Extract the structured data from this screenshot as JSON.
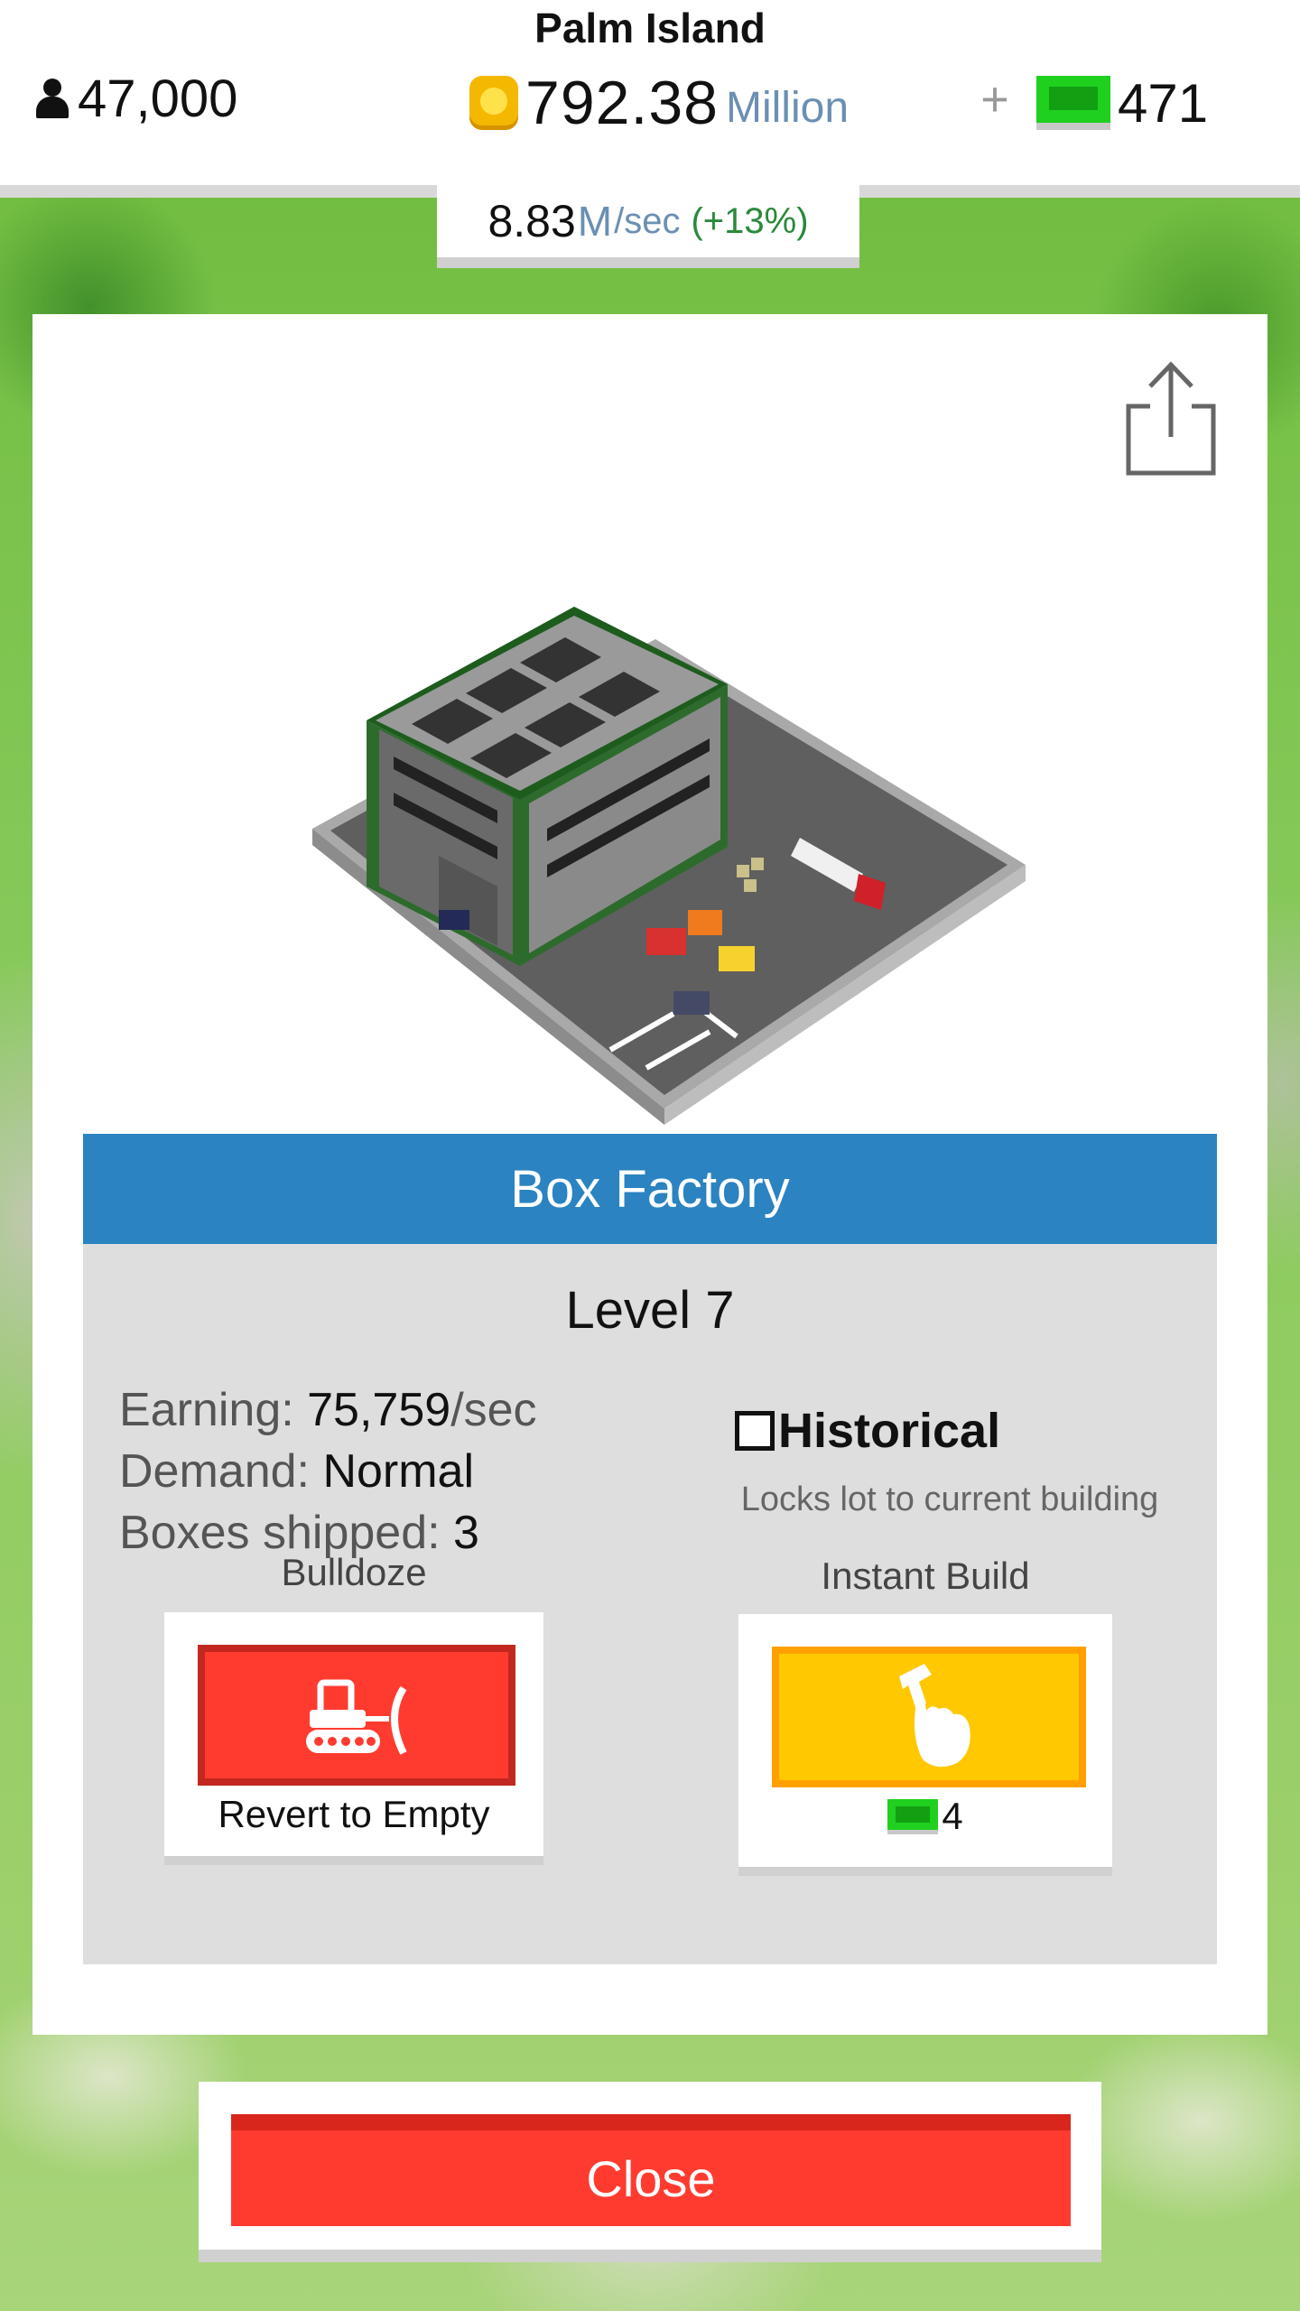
{
  "hud": {
    "island_name": "Palm Island",
    "population": "47,000",
    "coins_value": "792.38",
    "coins_unit": "Million",
    "plus_label": "+",
    "cash_value": "471",
    "rate": {
      "value": "8.83",
      "unit": "M",
      "per": "/sec",
      "change": "(+13%)"
    }
  },
  "building": {
    "name": "Box Factory",
    "level": "Level 7",
    "stats": {
      "earning_label": "Earning:",
      "earning_value": "75,759",
      "earning_unit": "/sec",
      "demand_label": "Demand:",
      "demand_value": "Normal",
      "shipped_label": "Boxes shipped:",
      "shipped_value": "3"
    },
    "historical": {
      "label": "Historical",
      "description": "Locks lot to current building",
      "checked": false
    }
  },
  "actions": {
    "bulldoze_label": "Bulldoze",
    "bulldoze_caption": "Revert to Empty",
    "instant_build_label": "Instant Build",
    "instant_build_cost": "4"
  },
  "close_label": "Close",
  "colors": {
    "title_bar": "#2b83c1",
    "bulldoze": "#ff3b30",
    "instant_build": "#ffc800",
    "close": "#ff3b30",
    "cash": "#1fd01f"
  },
  "icons": [
    "person-icon",
    "coin-icon",
    "cash-icon",
    "share-icon",
    "bulldozer-icon",
    "hammer-hand-icon"
  ]
}
